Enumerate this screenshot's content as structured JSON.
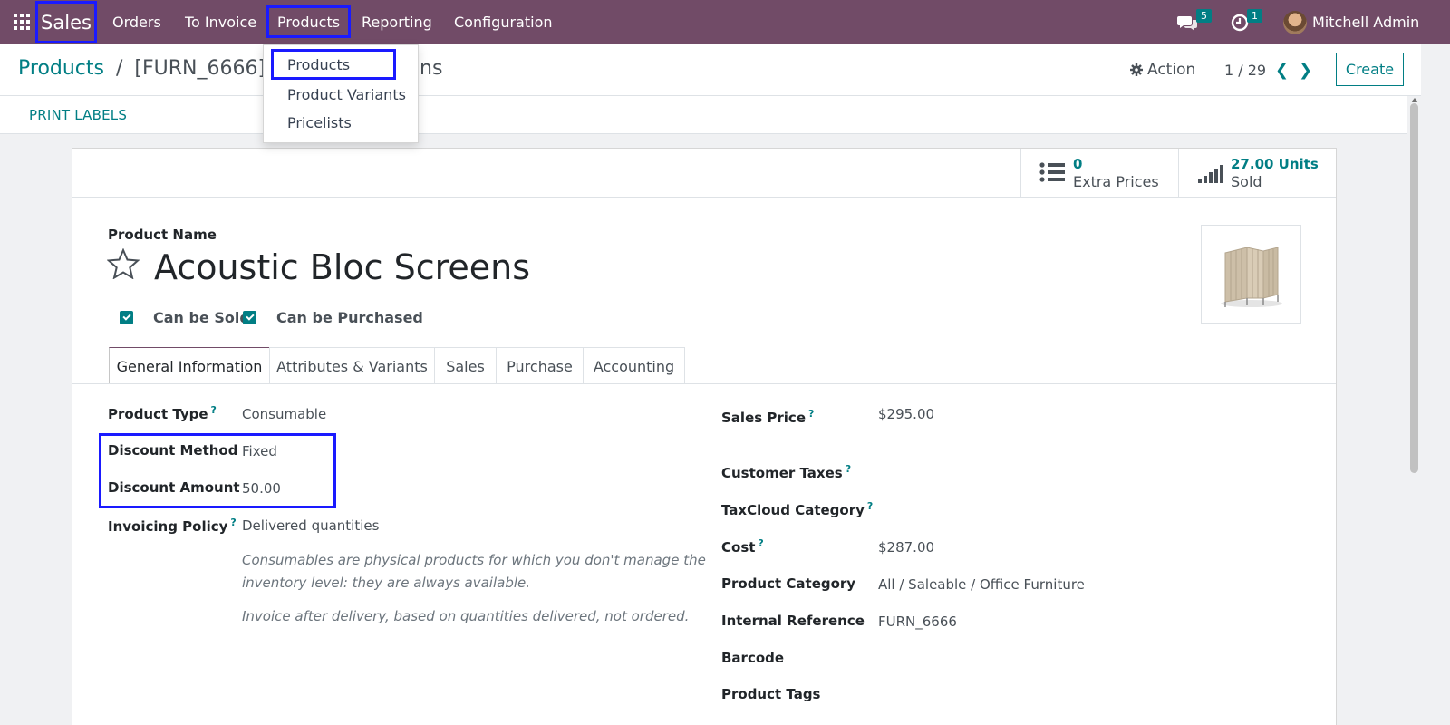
{
  "navbar": {
    "app_name": "Sales",
    "menu": [
      "Orders",
      "To Invoice",
      "Products",
      "Reporting",
      "Configuration"
    ],
    "messages_count": "5",
    "activities_count": "1",
    "user_name": "Mitchell Admin",
    "color": "#714b67"
  },
  "products_menu": {
    "items": [
      "Products",
      "Product Variants",
      "Pricelists"
    ]
  },
  "control_panel": {
    "breadcrumb_root": "Products",
    "breadcrumb_sep": "/",
    "breadcrumb_current": "[FURN_6666] Ac",
    "breadcrumb_current_tail": "ns",
    "action_label": "Action",
    "pager": "1 / 29",
    "create_label": "Create"
  },
  "statusbar": {
    "print_labels": "PRINT LABELS"
  },
  "smart_buttons": [
    {
      "icon": "list-icon",
      "value": "0",
      "label": "Extra Prices"
    },
    {
      "icon": "signal-icon",
      "value": "27.00 Units",
      "label": "Sold"
    }
  ],
  "product": {
    "name_label": "Product Name",
    "name": "Acoustic Bloc Screens",
    "can_be_sold": "Can be Sold",
    "can_be_purchased": "Can be Purchased"
  },
  "tabs": [
    "General Information",
    "Attributes & Variants",
    "Sales",
    "Purchase",
    "Accounting"
  ],
  "general": {
    "left": [
      {
        "label": "Product Type",
        "help": true,
        "value": "Consumable"
      },
      {
        "label": "Discount Method",
        "help": false,
        "value": "Fixed"
      },
      {
        "label": "Discount Amount",
        "help": false,
        "value": "50.00"
      },
      {
        "label": "Invoicing Policy",
        "help": true,
        "value": "Delivered quantities"
      }
    ],
    "help_text_1a": "Consumables are physical products for which you don't manage the",
    "help_text_1b": "inventory level: they are always available.",
    "help_text_2": "Invoice after delivery, based on quantities delivered, not ordered.",
    "right": [
      {
        "label": "Sales Price",
        "help": true,
        "value": "$295.00"
      },
      {
        "label": "Customer Taxes",
        "help": true,
        "value": ""
      },
      {
        "label": "TaxCloud Category",
        "help": true,
        "value": ""
      },
      {
        "label": "Cost",
        "help": true,
        "value": "$287.00"
      },
      {
        "label": "Product Category",
        "help": false,
        "value": "All / Saleable / Office Furniture"
      },
      {
        "label": "Internal Reference",
        "help": false,
        "value": "FURN_6666"
      },
      {
        "label": "Barcode",
        "help": false,
        "value": ""
      },
      {
        "label": "Product Tags",
        "help": false,
        "value": ""
      }
    ]
  },
  "help_mark": "?",
  "accent_color": "#017e84"
}
